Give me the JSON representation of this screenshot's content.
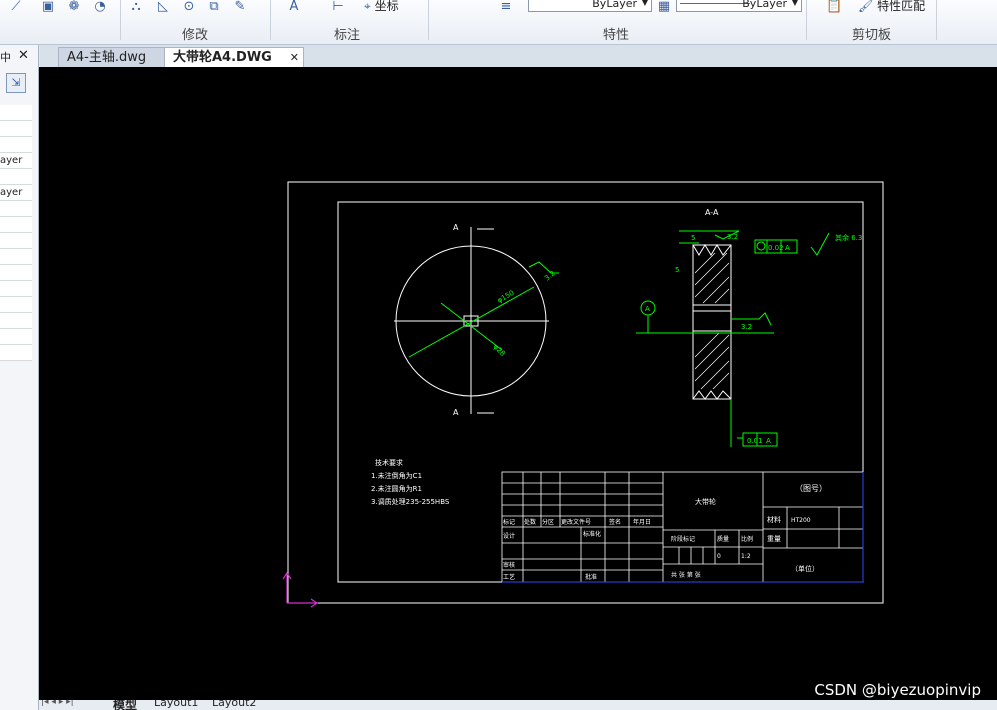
{
  "ribbon": {
    "groups": [
      {
        "label": "修改"
      },
      {
        "label": "标注"
      },
      {
        "label": "特性"
      },
      {
        "label": "剪切板"
      }
    ],
    "coord_label": "坐标",
    "linetype_value": "ByLayer",
    "color_value": "ByLayer",
    "match_label": "特性匹配"
  },
  "tabs": [
    {
      "label": "A4-主轴.dwg",
      "active": false
    },
    {
      "label": "大带轮A4.DWG",
      "active": true
    }
  ],
  "left_panel": {
    "rows": [
      "ayer",
      "ayer"
    ]
  },
  "drawing": {
    "section_label": "A-A",
    "cut_label": "A",
    "dim_diameter_large": "φ150",
    "dim_diameter_small": "φ28",
    "roughness_1": "3.2",
    "roughness_2": "3.2",
    "roughness_rest": "其余 6.3",
    "dim_5a": "5",
    "dim_5b": "5",
    "tolerance_1": "0.02",
    "tolerance_1_ref": "A",
    "tolerance_2": "0.01",
    "tolerance_2_ref": "A",
    "datum": "A",
    "tech_title": "技术要求",
    "tech_lines": [
      "1.未注倒角为C1",
      "2.未注圆角为R1",
      "3.调质处理235-255HBS"
    ],
    "title_block": {
      "part_name": "大带轮",
      "drawing_no": "（图号）",
      "material_label": "材料",
      "material_value": "HT200",
      "weight_label": "重量",
      "header_row": [
        "标记",
        "处数",
        "分区",
        "更改文件号",
        "签名",
        "年月日"
      ],
      "design": "设计",
      "standard": "标准化",
      "review": "审核",
      "process": "工艺",
      "approve": "批准",
      "stage_label": "阶段标记",
      "mass_label": "质量",
      "scale_label": "比例",
      "mass_value": "0",
      "scale_value": "1:2",
      "sheets": "共  张  第  张",
      "unit": "（单位）"
    }
  },
  "layout_tabs": [
    "模型",
    "Layout1",
    "Layout2"
  ],
  "watermark": "CSDN @biyezuopinvip"
}
